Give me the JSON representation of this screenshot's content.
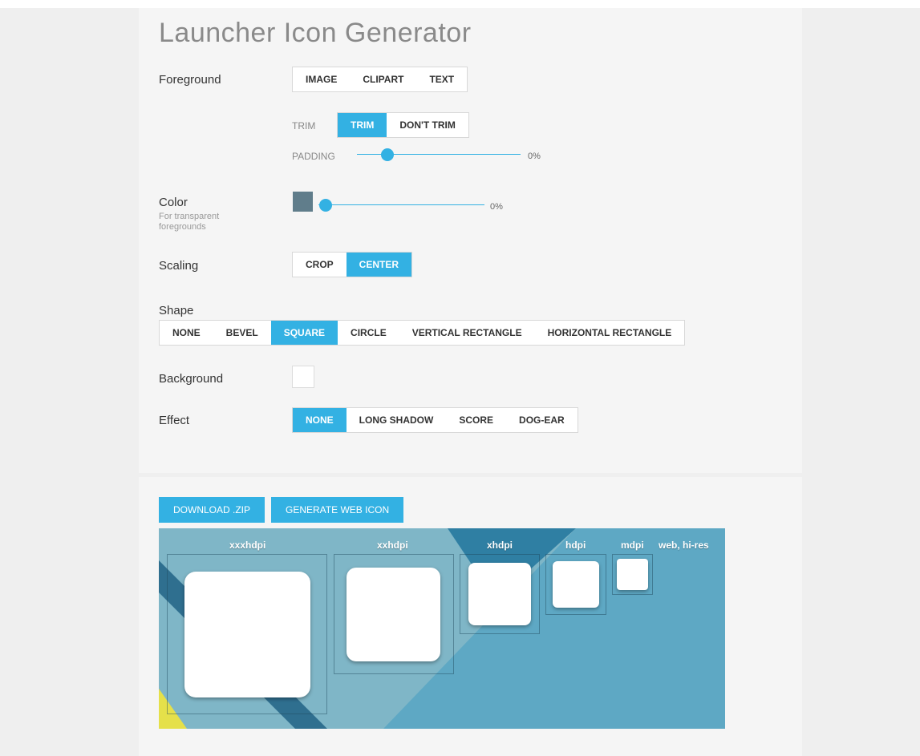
{
  "title": "Launcher Icon Generator",
  "foreground": {
    "label": "Foreground",
    "options": [
      "IMAGE",
      "CLIPART",
      "TEXT"
    ],
    "trim": {
      "caption": "TRIM",
      "options": [
        "TRIM",
        "DON'T TRIM"
      ],
      "selected": "TRIM"
    },
    "padding": {
      "caption": "PADDING",
      "value_text": "0%",
      "value": 0.0
    }
  },
  "color": {
    "label": "Color",
    "sublabel": "For transparent foregrounds",
    "swatch": "#607d8b",
    "value_text": "0%",
    "value": 0.0
  },
  "scaling": {
    "label": "Scaling",
    "options": [
      "CROP",
      "CENTER"
    ],
    "selected": "CENTER"
  },
  "shape": {
    "label": "Shape",
    "options": [
      "NONE",
      "BEVEL",
      "SQUARE",
      "CIRCLE",
      "VERTICAL RECTANGLE",
      "HORIZONTAL RECTANGLE"
    ],
    "selected": "SQUARE"
  },
  "background": {
    "label": "Background",
    "swatch": "#ffffff"
  },
  "effect": {
    "label": "Effect",
    "options": [
      "NONE",
      "LONG SHADOW",
      "SCORE",
      "DOG-EAR"
    ],
    "selected": "NONE"
  },
  "actions": {
    "download": "DOWNLOAD .ZIP",
    "generate_web": "GENERATE WEB ICON"
  },
  "preview": {
    "densities": [
      "xxxhdpi",
      "xxhdpi",
      "xhdpi",
      "hdpi",
      "mdpi",
      "web, hi-res"
    ]
  },
  "colors": {
    "accent": "#33b1e3"
  }
}
